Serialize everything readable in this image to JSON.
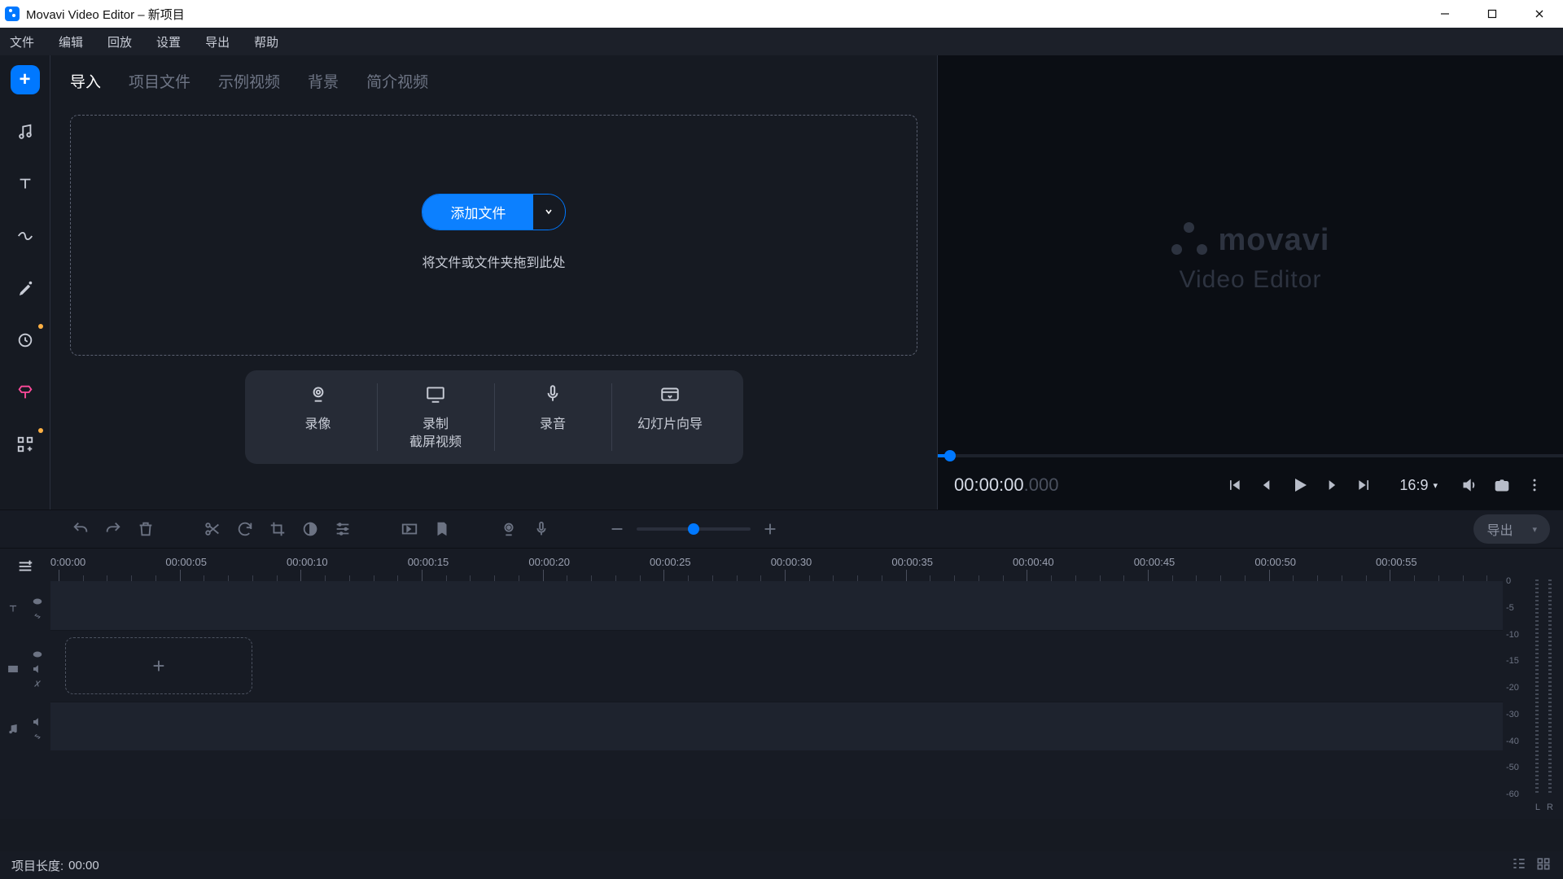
{
  "titlebar": {
    "title": "Movavi Video Editor – 新项目"
  },
  "menubar": [
    "文件",
    "编辑",
    "回放",
    "设置",
    "导出",
    "帮助"
  ],
  "tabs": {
    "items": [
      "导入",
      "项目文件",
      "示例视频",
      "背景",
      "简介视频"
    ],
    "active": 0
  },
  "drop": {
    "add_files": "添加文件",
    "hint": "将文件或文件夹拖到此处"
  },
  "capture": {
    "record_camera": "录像",
    "record_screen": "录制\n截屏视频",
    "record_audio": "录音",
    "slideshow": "幻灯片向导"
  },
  "brand": {
    "name": "movavi",
    "sub": "Video Editor"
  },
  "preview": {
    "time_main": "00:00:00",
    "time_ms": ".000",
    "aspect": "16:9"
  },
  "toolbar": {
    "export": "导出"
  },
  "ruler_labels": [
    "00:00:00",
    "00:00:05",
    "00:00:10",
    "00:00:15",
    "00:00:20",
    "00:00:25",
    "00:00:30",
    "00:00:35",
    "00:00:40",
    "00:00:45",
    "00:00:50",
    "00:00:55"
  ],
  "meter_labels": [
    "0",
    "-5",
    "-10",
    "-15",
    "-20",
    "-30",
    "-40",
    "-50",
    "-60"
  ],
  "meter_L": "L",
  "meter_R": "R",
  "statusbar": {
    "label": "项目长度:",
    "value": "00:00"
  }
}
